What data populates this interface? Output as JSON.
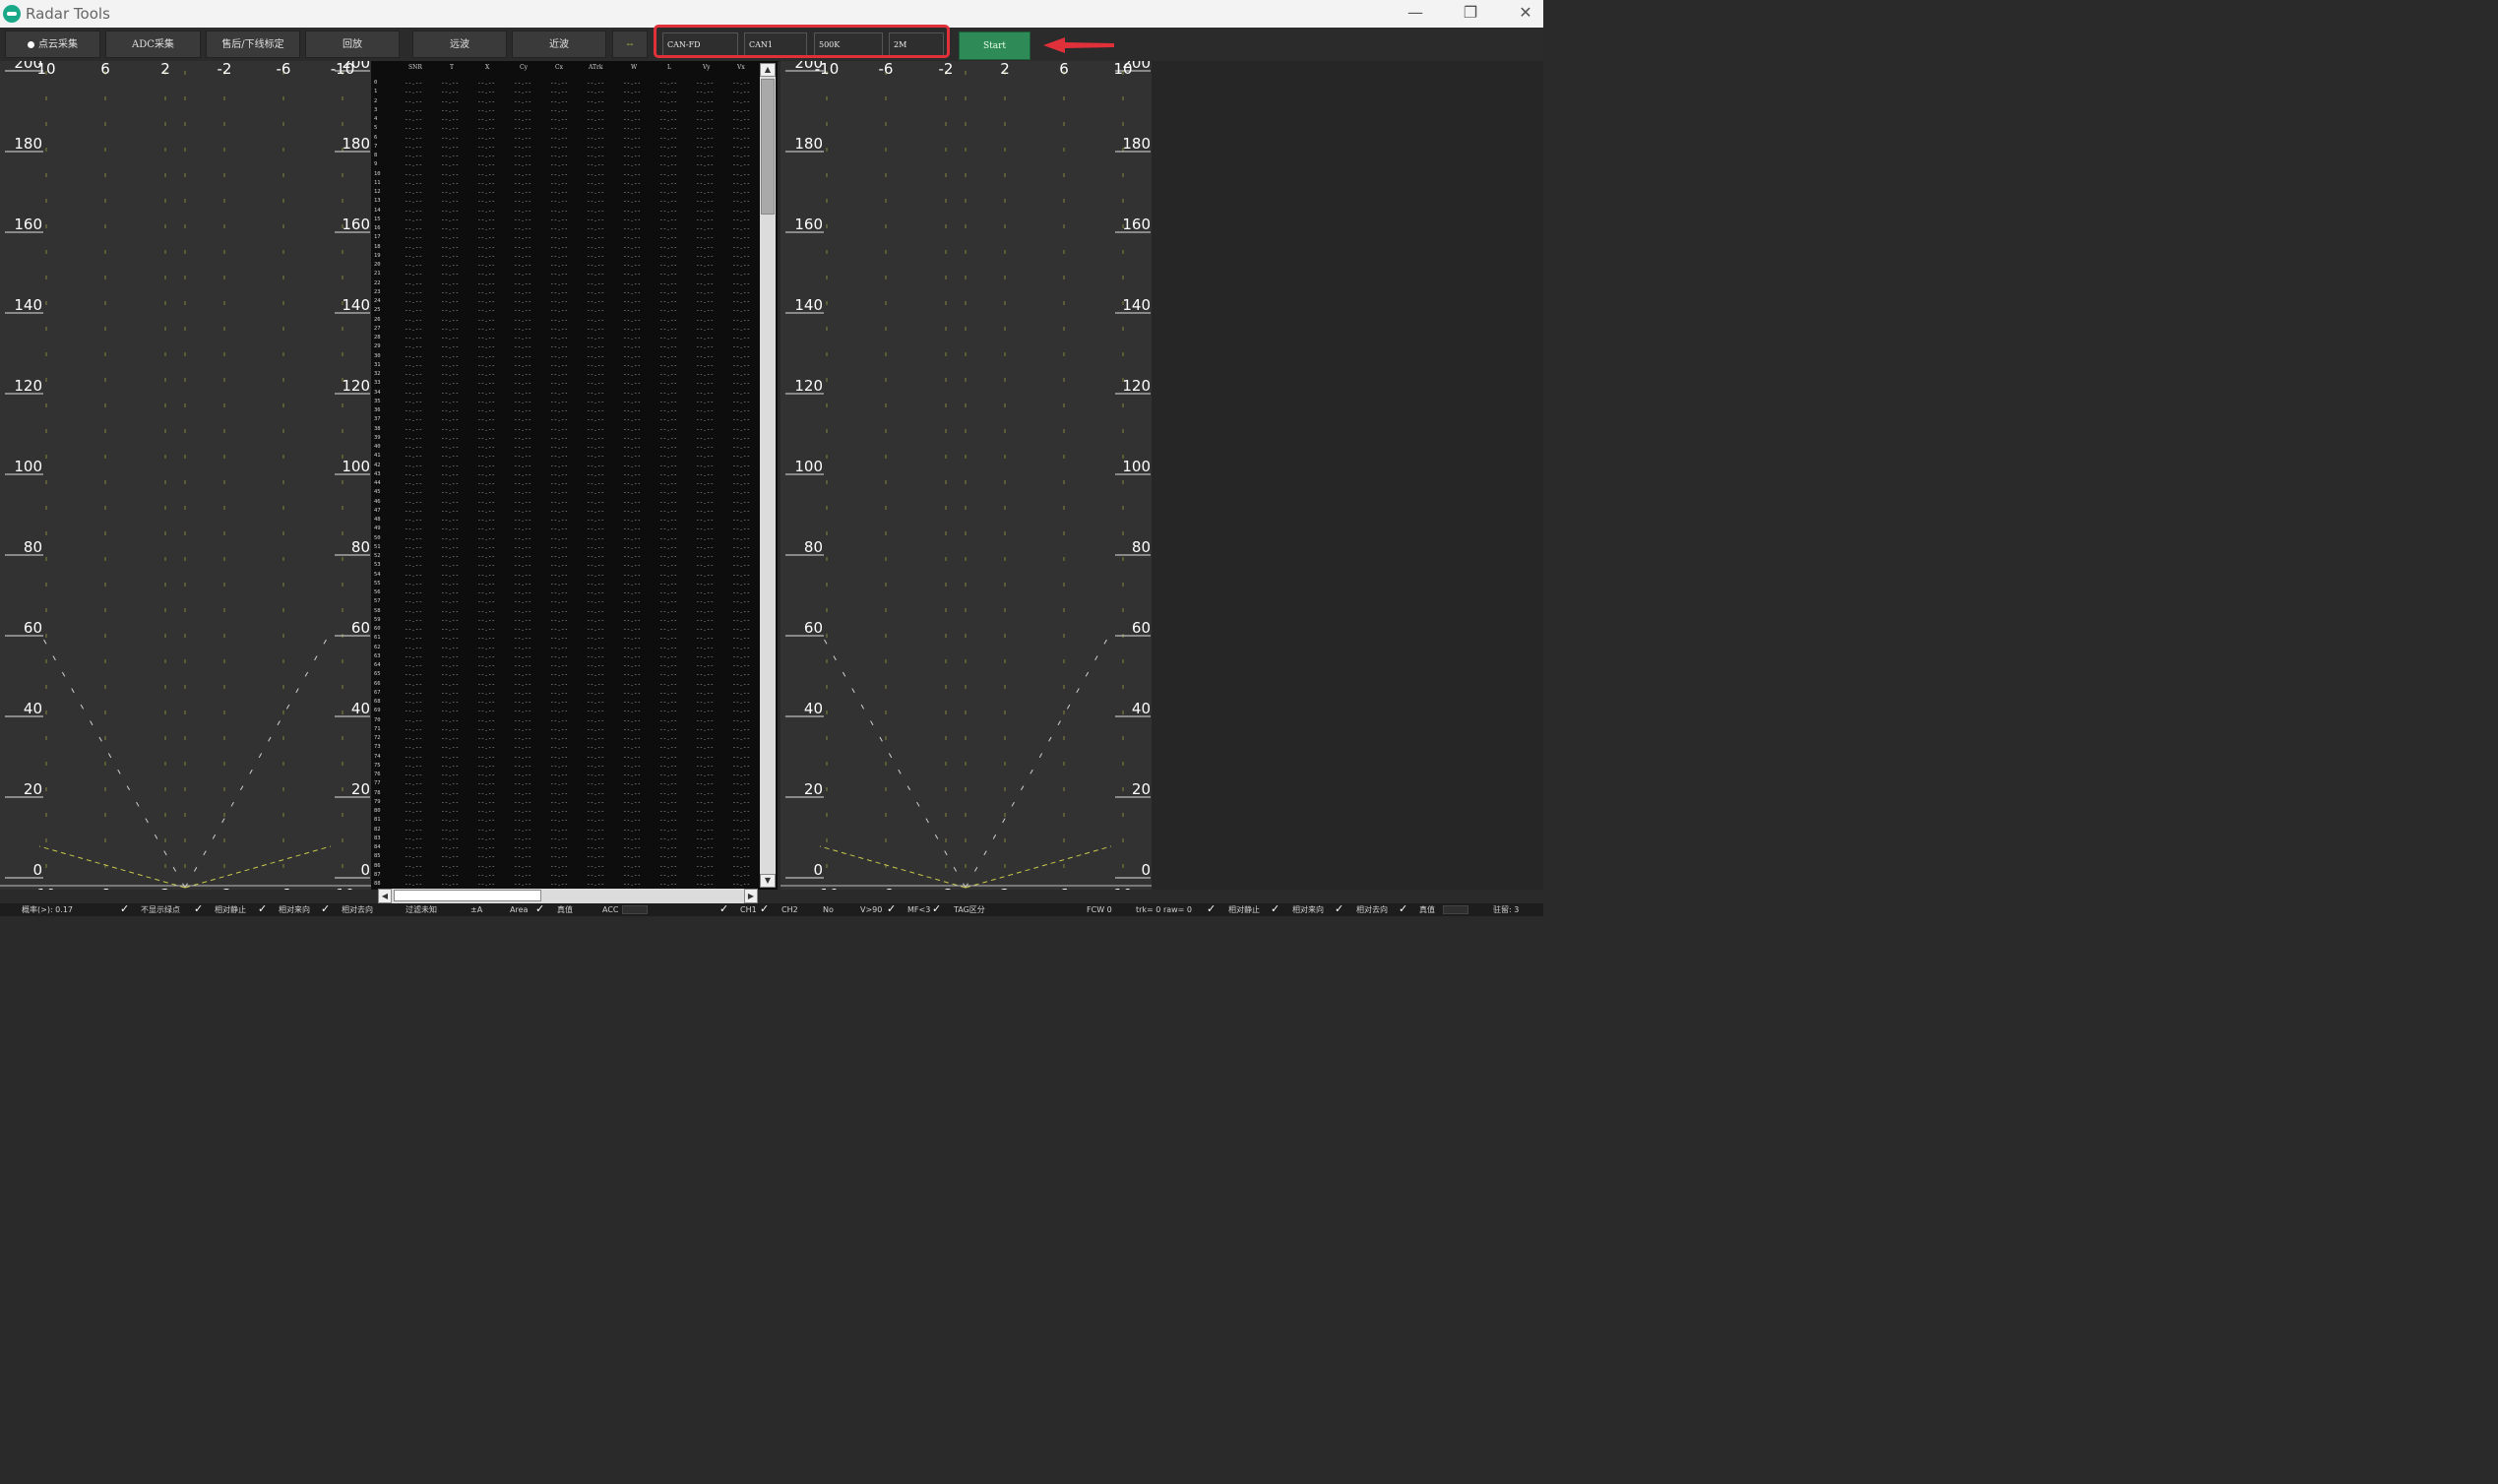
{
  "window": {
    "title": "Radar Tools",
    "minimize": "—",
    "restore": "❐",
    "close": "✕"
  },
  "toolbar": {
    "btn_cloud": "点云采集",
    "btn_adc": "ADC采集",
    "btn_calib": "售后/下线标定",
    "btn_playback": "回放",
    "btn_far": "远波",
    "btn_near": "近波",
    "btn_dash": "--",
    "field_mode": "CAN-FD",
    "field_channel": "CAN1",
    "field_baud": "500K",
    "field_data_baud": "2M",
    "start_label": "Start"
  },
  "plot": {
    "y_ticks": [
      "200",
      "180",
      "160",
      "140",
      "120",
      "100",
      "80",
      "60",
      "40",
      "20",
      "0"
    ],
    "left_x_ticks": [
      "10",
      "6",
      "2",
      "-2",
      "-6",
      "-10"
    ],
    "right_x_ticks": [
      "-10",
      "-6",
      "-2",
      "2",
      "6",
      "10"
    ]
  },
  "table": {
    "columns": [
      "SNR",
      "T",
      "X",
      "Cy",
      "Cx",
      "ATrk",
      "W",
      "L",
      "Vy",
      "Vx"
    ],
    "placeholder": "--.--",
    "row_count": 89
  },
  "colors": {
    "accent_green": "#2e8b57",
    "highlight_red": "#e0303a",
    "grid_yellow": "#c8c84a"
  },
  "status": {
    "prob": "概率(>): 0.17",
    "hide_green": "不显示绿点",
    "rel_static_l": "相对静止",
    "rel_incoming_l": "相对来向",
    "rel_outgoing_l": "相对去向",
    "filter_unknown": "过滤未知",
    "pm_a": "±A",
    "area": "Area",
    "true_val_l": "真值",
    "acc": "ACC",
    "ch1": "CH1",
    "ch2": "CH2",
    "no": "No",
    "v90": "V>90",
    "mf3": "MF<3",
    "tag_split": "TAG区分",
    "fcw": "FCW 0",
    "trk": "trk= 0 raw= 0",
    "rel_static_r": "相对静止",
    "rel_incoming_r": "相对来向",
    "rel_outgoing_r": "相对去向",
    "true_val_r": "真值",
    "stay": "驻留: 3"
  }
}
